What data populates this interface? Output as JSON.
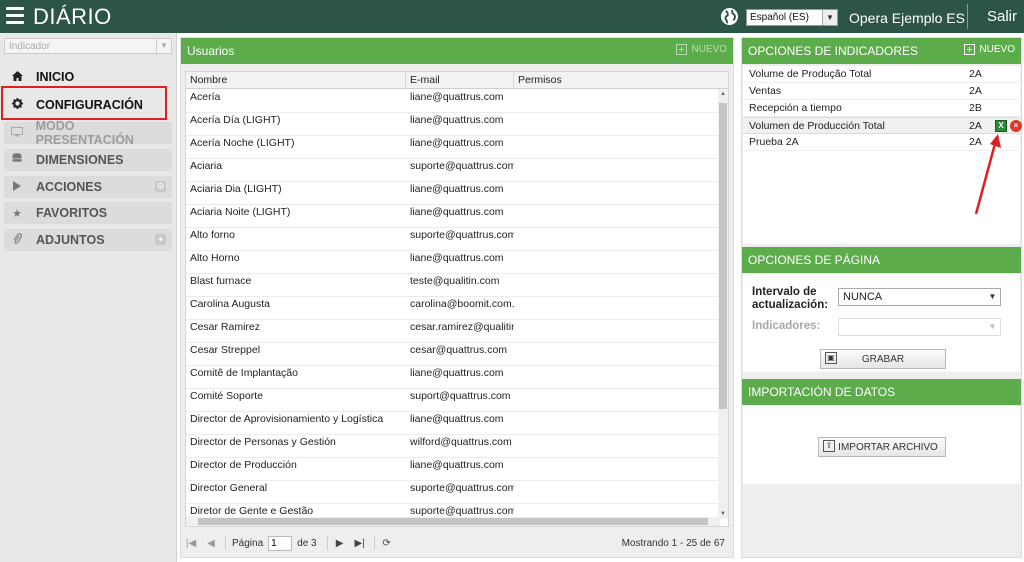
{
  "app": {
    "title": "DIÁRIO"
  },
  "topbar": {
    "language": "Español (ES)",
    "company": "Opera Ejemplo ES",
    "logout": "Salir"
  },
  "sidebar": {
    "indicator_placeholder": "Indicador",
    "items": [
      {
        "label": "INICIO",
        "icon": "home-icon"
      },
      {
        "label": "CONFIGURACIÓN",
        "icon": "gear-icon"
      },
      {
        "label": "MODO PRESENTACIÓN",
        "icon": "monitor-icon"
      },
      {
        "label": "DIMENSIONES",
        "icon": "database-icon"
      },
      {
        "label": "ACCIONES",
        "icon": "play-icon"
      },
      {
        "label": "FAVORITOS",
        "icon": "star-icon"
      },
      {
        "label": "ADJUNTOS",
        "icon": "paperclip-icon"
      }
    ]
  },
  "users": {
    "title": "Usuarios",
    "new_label": "NUEVO",
    "columns": [
      "Nombre",
      "E-mail",
      "Permisos"
    ],
    "rows": [
      {
        "name": "Acería",
        "email": "liane@quattrus.com"
      },
      {
        "name": "Acería Día (LIGHT)",
        "email": "liane@quattrus.com"
      },
      {
        "name": "Acería Noche (LIGHT)",
        "email": "liane@quattrus.com"
      },
      {
        "name": "Aciaria",
        "email": "suporte@quattrus.com"
      },
      {
        "name": "Aciaria Dia (LIGHT)",
        "email": "liane@quattrus.com"
      },
      {
        "name": "Aciaria Noite (LIGHT)",
        "email": "liane@quattrus.com"
      },
      {
        "name": "Alto forno",
        "email": "suporte@quattrus.com"
      },
      {
        "name": "Alto Horno",
        "email": "liane@quattrus.com"
      },
      {
        "name": "Blast furnace",
        "email": "teste@qualitin.com"
      },
      {
        "name": "Carolina Augusta",
        "email": "carolina@boomit.com.br"
      },
      {
        "name": "Cesar Ramirez",
        "email": "cesar.ramirez@qualitin..."
      },
      {
        "name": "Cesar Streppel",
        "email": "cesar@quattrus.com"
      },
      {
        "name": "Comitê de Implantação",
        "email": "liane@quattrus.com"
      },
      {
        "name": "Comité Soporte",
        "email": "suport@quattrus.com"
      },
      {
        "name": "Director de Aprovisionamiento y Logística",
        "email": "liane@quattrus.com"
      },
      {
        "name": "Director de Personas y Gestión",
        "email": "wilford@quattrus.com"
      },
      {
        "name": "Director de Producción",
        "email": "liane@quattrus.com"
      },
      {
        "name": "Director General",
        "email": "suporte@quattrus.com"
      },
      {
        "name": "Diretor de Gente e Gestão",
        "email": "suporte@quattrus.com"
      }
    ],
    "pager": {
      "page_label": "Página",
      "page_value": "1",
      "of_label": "de 3",
      "showing": "Mostrando 1 - 25 de 67"
    }
  },
  "indicator_options": {
    "title": "OPCIONES DE INDICADORES",
    "new_label": "NUEVO",
    "rows": [
      {
        "name": "Volume de Produção Total",
        "code": "2A"
      },
      {
        "name": "Ventas",
        "code": "2A"
      },
      {
        "name": "Recepción a tiempo",
        "code": "2B"
      },
      {
        "name": "Volumen de Producción Total",
        "code": "2A"
      },
      {
        "name": "Prueba 2A",
        "code": "2A"
      }
    ],
    "excel_glyph": "X",
    "delete_glyph": "×"
  },
  "page_options": {
    "title": "OPCIONES DE PÁGINA",
    "interval_label_1": "Intervalo de",
    "interval_label_2": "actualización:",
    "interval_value": "NUNCA",
    "indicators_label": "Indicadores:",
    "save_label": "GRABAR"
  },
  "import": {
    "title": "IMPORTACIÓN DE DATOS",
    "button_label": "IMPORTAR ARCHIVO"
  },
  "colors": {
    "topbar": "#2c5447",
    "panel_header": "#5cac4c",
    "highlight": "#e02020"
  }
}
